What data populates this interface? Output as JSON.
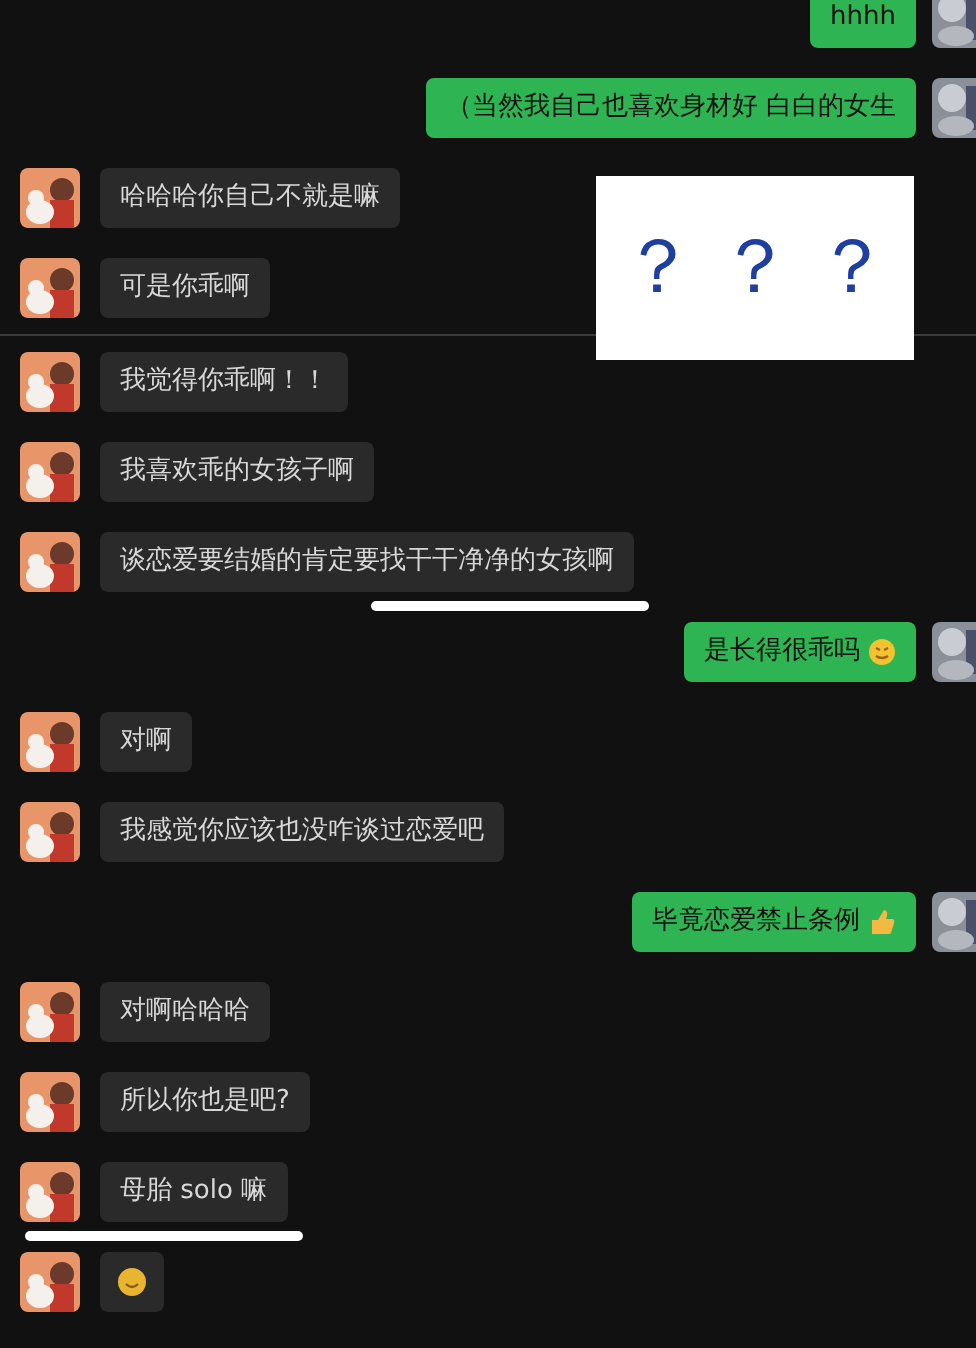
{
  "messages": [
    {
      "kind": "sent",
      "text": "hhhh"
    },
    {
      "kind": "sent",
      "text": "（当然我自己也喜欢身材好 白白的女生"
    },
    {
      "kind": "received",
      "text": "哈哈哈你自己不就是嘛"
    },
    {
      "kind": "received",
      "text": "可是你乖啊",
      "divider_after": true
    },
    {
      "kind": "received",
      "text": "我觉得你乖啊！！"
    },
    {
      "kind": "received",
      "text": "我喜欢乖的女孩子啊"
    },
    {
      "kind": "received",
      "text": "谈恋爱要结婚的肯定要找干干净净的女孩啊",
      "underlined": true
    },
    {
      "kind": "sent",
      "text": "是长得很乖吗",
      "trailing_icon": {
        "kind": "face"
      }
    },
    {
      "kind": "received",
      "text": "对啊"
    },
    {
      "kind": "received",
      "text": "我感觉你应该也没咋谈过恋爱吧"
    },
    {
      "kind": "sent",
      "text": "毕竟恋爱禁止条例",
      "trailing_icon": {
        "kind": "thumb"
      }
    },
    {
      "kind": "received",
      "text": "对啊哈哈哈"
    },
    {
      "kind": "received",
      "text": "所以你也是吧?"
    },
    {
      "kind": "received",
      "text": "母胎 solo 嘛",
      "underlined": true
    },
    {
      "kind": "sticker"
    }
  ],
  "annotation": {
    "text": "？ ？ ？"
  }
}
